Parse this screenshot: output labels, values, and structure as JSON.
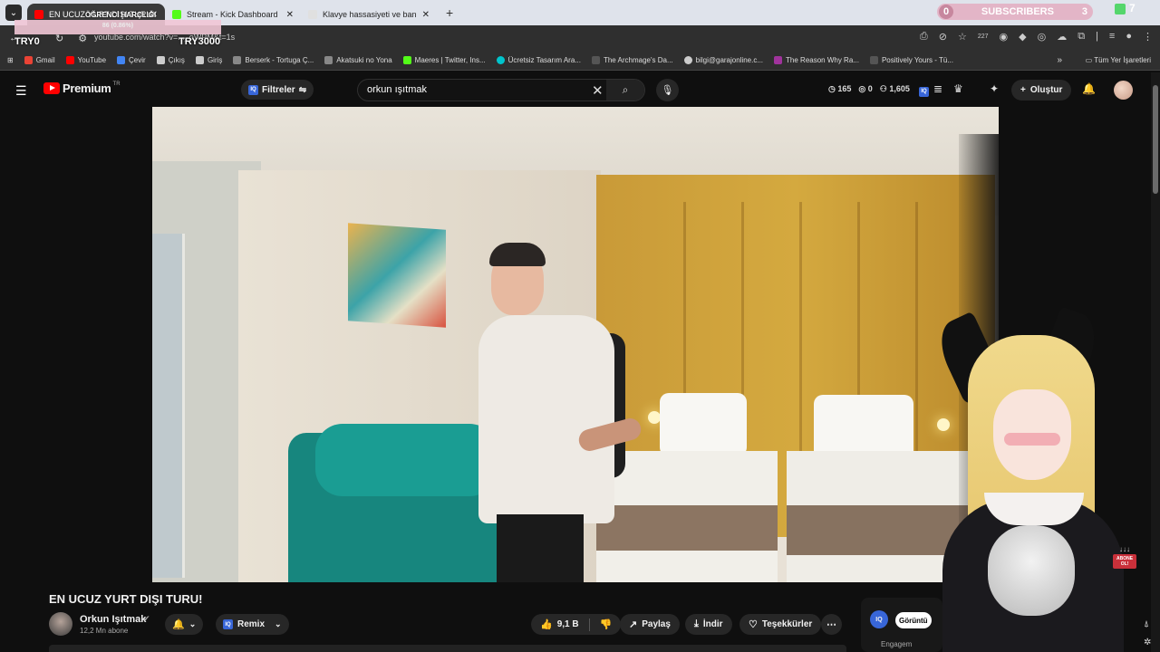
{
  "browser": {
    "tabs": [
      {
        "label": "EN UCUZ YURT DIŞI TURU!",
        "favicon_color": "#ff0000"
      },
      {
        "label": "Stream - Kick Dashboard",
        "favicon_color": "#53fc18"
      },
      {
        "label": "Klavye hassasiyeti ve ban",
        "favicon_color": "#e0e0e0"
      }
    ],
    "url": "youtube.com/watch?v=..._oWPM&t=1s",
    "extension_badge": "227",
    "bookmarks": [
      {
        "label": "Gmail",
        "color": "#ea4335"
      },
      {
        "label": "YouTube",
        "color": "#ff0000"
      },
      {
        "label": "Çevir",
        "color": "#4285f4"
      },
      {
        "label": "Çıkış",
        "color": "#cccccc"
      },
      {
        "label": "Giriş",
        "color": "#cccccc"
      },
      {
        "label": "Berserk - Tortuga Ç...",
        "color": "#888888"
      },
      {
        "label": "Akatsuki no Yona",
        "color": "#888888"
      },
      {
        "label": "Maeres | Twitter, Ins...",
        "color": "#53fc18"
      },
      {
        "label": "Ücretsiz Tasarım Ara...",
        "color": "#00c4cc"
      },
      {
        "label": "The Archmage's Da...",
        "color": "#333333"
      },
      {
        "label": "bilgi@garajonline.c...",
        "color": "#cccccc"
      },
      {
        "label": "The Reason Why Ra...",
        "color": "#a0339c"
      },
      {
        "label": "Positively Yours - Tü...",
        "color": "#333333"
      }
    ],
    "all_bookmarks": "Tüm Yer İşaretleri"
  },
  "overlay": {
    "subs_left": "0",
    "subs_label": "SUBSCRIBERS",
    "subs_right": "3",
    "counter": "7",
    "title": "ÖĞRENCİ HARÇLIĞI",
    "progress": "86 (0.86%)",
    "try_left": "TRY0",
    "try_right": "TRY3000"
  },
  "yt": {
    "logo_text": "Premium",
    "logo_region": "TR",
    "filters_label": "Filtreler",
    "search_value": "orkun ışıtmak",
    "stats": {
      "a": "165",
      "b": "0",
      "c": "1,605"
    },
    "create_label": "Oluştur"
  },
  "video": {
    "title": "EN UCUZ YURT DIŞI TURU!",
    "channel": "Orkun Işıtmak",
    "subscribers": "12,2 Mn abone",
    "remix_label": "Remix",
    "likes": "9,1 B",
    "share_label": "Paylaş",
    "download_label": "İndir",
    "thanks_label": "Teşekkürler",
    "engage_button": "Görüntü",
    "engage_label": "Engagem"
  },
  "vtuber": {
    "abone_label": "ABONE OL!"
  }
}
